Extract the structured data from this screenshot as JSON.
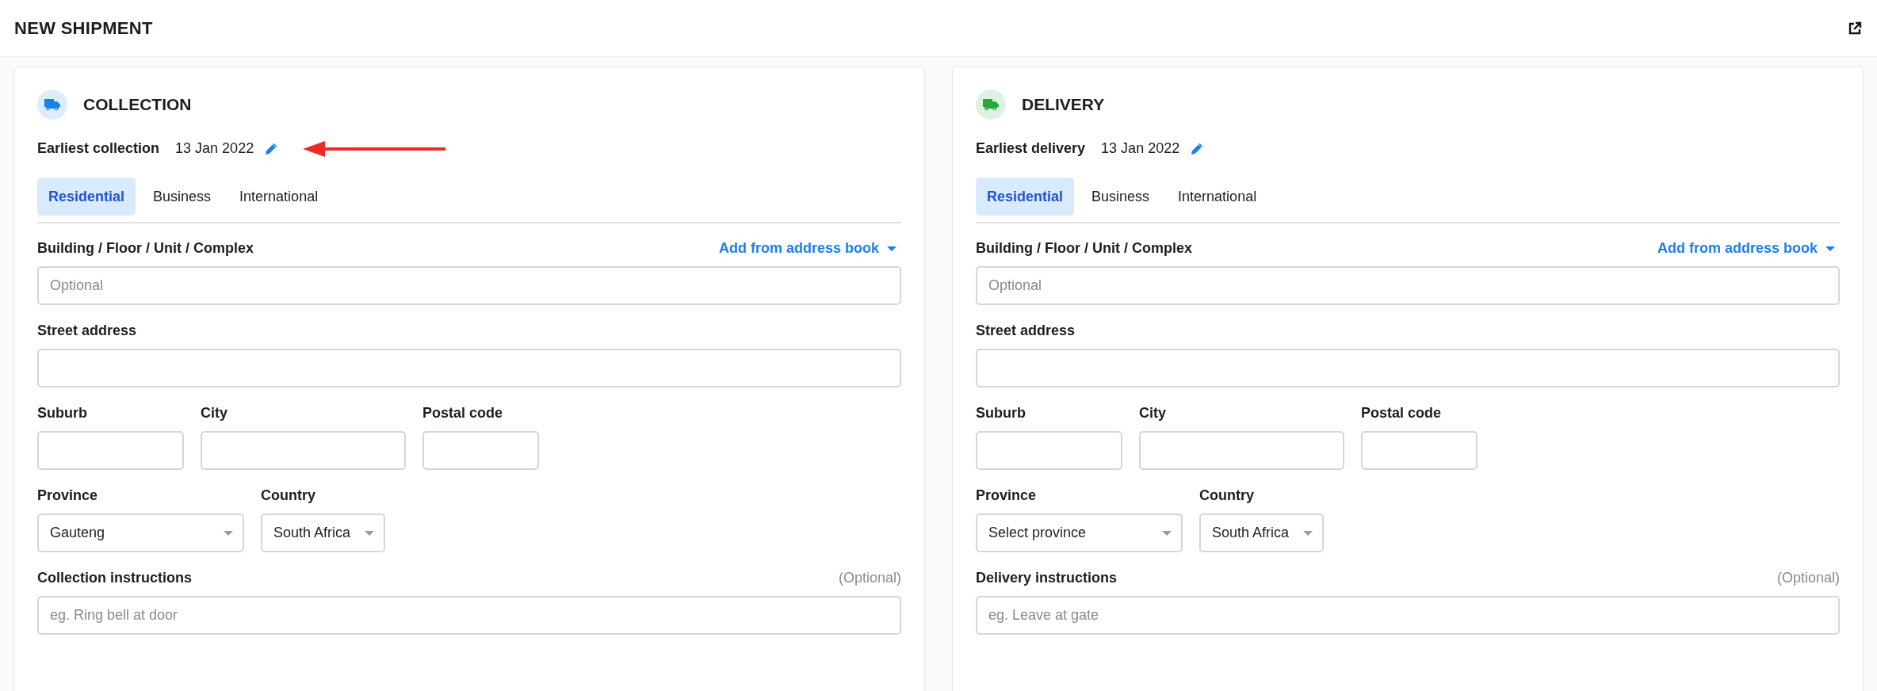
{
  "page": {
    "title": "NEW SHIPMENT"
  },
  "panels": [
    {
      "title": "COLLECTION",
      "color": "#1a7ff0",
      "date_label": "Earliest collection",
      "date": "13 Jan 2022",
      "annotated": true,
      "tabs": [
        {
          "label": "Residential",
          "selected": true
        },
        {
          "label": "Business",
          "selected": false
        },
        {
          "label": "International",
          "selected": false
        }
      ],
      "rows": [
        [
          {
            "kind": "text",
            "label": "Building / Floor / Unit / Complex",
            "placeholder": "Optional",
            "aside": {
              "kind": "link",
              "text": "Add from address book"
            }
          }
        ],
        [
          {
            "kind": "text",
            "label": "Street address"
          }
        ],
        [
          {
            "kind": "text",
            "label": "Suburb"
          },
          {
            "kind": "text",
            "label": "City"
          },
          {
            "kind": "text",
            "label": "Postal code"
          }
        ],
        [
          {
            "kind": "select",
            "label": "Province",
            "value": "Gauteng"
          },
          {
            "kind": "select",
            "label": "Country",
            "value": "South Africa"
          }
        ],
        [
          {
            "kind": "text",
            "label": "Collection instructions",
            "placeholder": "eg. Ring bell at door",
            "aside": {
              "kind": "note",
              "text": "(Optional)"
            }
          }
        ]
      ]
    },
    {
      "title": "DELIVERY",
      "color": "#1faa3c",
      "date_label": "Earliest delivery",
      "date": "13 Jan 2022",
      "annotated": false,
      "tabs": [
        {
          "label": "Residential",
          "selected": true
        },
        {
          "label": "Business",
          "selected": false
        },
        {
          "label": "International",
          "selected": false
        }
      ],
      "rows": [
        [
          {
            "kind": "text",
            "label": "Building / Floor / Unit / Complex",
            "placeholder": "Optional",
            "aside": {
              "kind": "link",
              "text": "Add from address book"
            }
          }
        ],
        [
          {
            "kind": "text",
            "label": "Street address"
          }
        ],
        [
          {
            "kind": "text",
            "label": "Suburb"
          },
          {
            "kind": "text",
            "label": "City"
          },
          {
            "kind": "text",
            "label": "Postal code"
          }
        ],
        [
          {
            "kind": "select",
            "label": "Province",
            "value": "Select province"
          },
          {
            "kind": "select",
            "label": "Country",
            "value": "South Africa"
          }
        ],
        [
          {
            "kind": "text",
            "label": "Delivery instructions",
            "placeholder": "eg. Leave at gate",
            "aside": {
              "kind": "note",
              "text": "(Optional)"
            }
          }
        ]
      ]
    }
  ]
}
